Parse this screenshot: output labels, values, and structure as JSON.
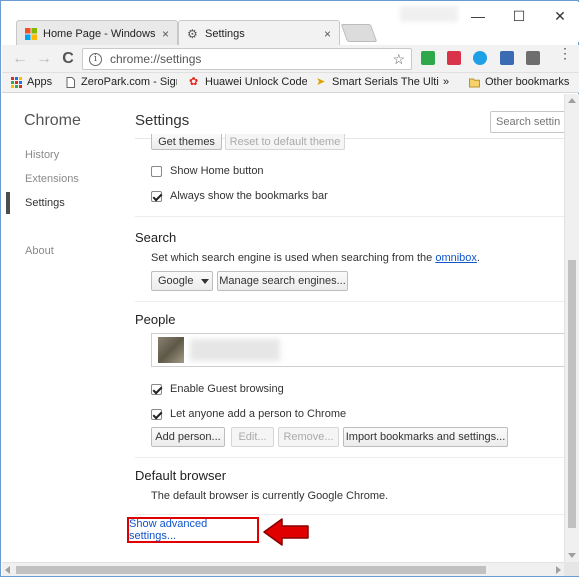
{
  "tabs": [
    {
      "label": "Home Page - Windows T",
      "close": "×"
    },
    {
      "label": "Settings",
      "close": "×"
    }
  ],
  "window_controls": {
    "minimize": "—",
    "maximize": "☐",
    "close": "✕"
  },
  "toolbar": {
    "back": "←",
    "forward": "→",
    "reload": "C",
    "info_icon": "i",
    "url": "chrome://settings",
    "star": "☆",
    "menu": "⋮"
  },
  "bookmarks": {
    "items": [
      "Apps",
      "ZeroPark.com - Sign i",
      "Huawei Unlock Code",
      "Smart Serials The Ulti"
    ],
    "overflow": "»",
    "other": "Other bookmarks"
  },
  "sidebar": {
    "title": "Chrome",
    "items": [
      "History",
      "Extensions",
      "Settings",
      "About"
    ],
    "active": "Settings"
  },
  "main": {
    "title": "Settings",
    "search_placeholder": "Search settings",
    "appearance": {
      "get_themes": "Get themes",
      "reset_theme": "Reset to default theme",
      "show_home_button": {
        "label": "Show Home button",
        "checked": false
      },
      "show_bookmarks_bar": {
        "label": "Always show the bookmarks bar",
        "checked": true
      }
    },
    "search": {
      "title": "Search",
      "desc_prefix": "Set which search engine is used when searching from the ",
      "desc_link": "omnibox",
      "desc_suffix": ".",
      "engine": "Google",
      "manage": "Manage search engines..."
    },
    "people": {
      "title": "People",
      "guest_browsing": {
        "label": "Enable Guest browsing",
        "checked": true
      },
      "anyone_add": {
        "label": "Let anyone add a person to Chrome",
        "checked": true
      },
      "add_person": "Add person...",
      "edit": "Edit...",
      "remove": "Remove...",
      "import": "Import bookmarks and settings..."
    },
    "default_browser": {
      "title": "Default browser",
      "desc": "The default browser is currently Google Chrome."
    },
    "advanced_link": "Show advanced settings..."
  },
  "colors": {
    "highlight_border": "#e00000",
    "arrow": "#e00000",
    "link": "#1155cc"
  }
}
